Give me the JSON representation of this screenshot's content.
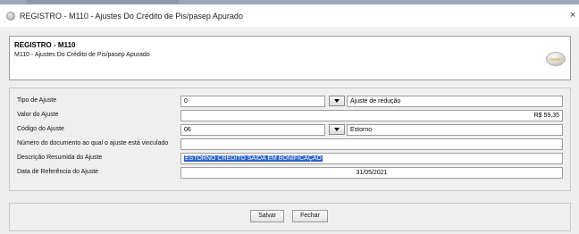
{
  "window": {
    "title": "REGISTRO - M110 - Ajustes Do Crédito de Pis/pasep Apurado",
    "close_glyph": "×"
  },
  "header": {
    "title": "REGISTRO - M110",
    "subtitle": "M110 - Ajustes Do Crédito de Pis/pasep Apurado"
  },
  "form": {
    "tipo_ajuste": {
      "label": "Tipo de Ajuste",
      "code": "0",
      "description": "Ajuste de redução"
    },
    "valor_ajuste": {
      "label": "Valor do Ajuste",
      "value": "R$ 59,35"
    },
    "codigo_ajuste": {
      "label": "Código do Ajuste",
      "code": "06",
      "description": "Estorno"
    },
    "numero_documento": {
      "label": "Número do documento ao qual o ajuste está vinculado",
      "value": ""
    },
    "descricao": {
      "label": "Descrição Resumida do Ajuste",
      "value": "ESTORNO CRÉDITO SAIDA EM BONIFICAÇÃO"
    },
    "data_referencia": {
      "label": "Data de Referência do Ajuste",
      "value": "31/05/2021"
    }
  },
  "buttons": {
    "save": "Salvar",
    "close": "Fechar"
  }
}
